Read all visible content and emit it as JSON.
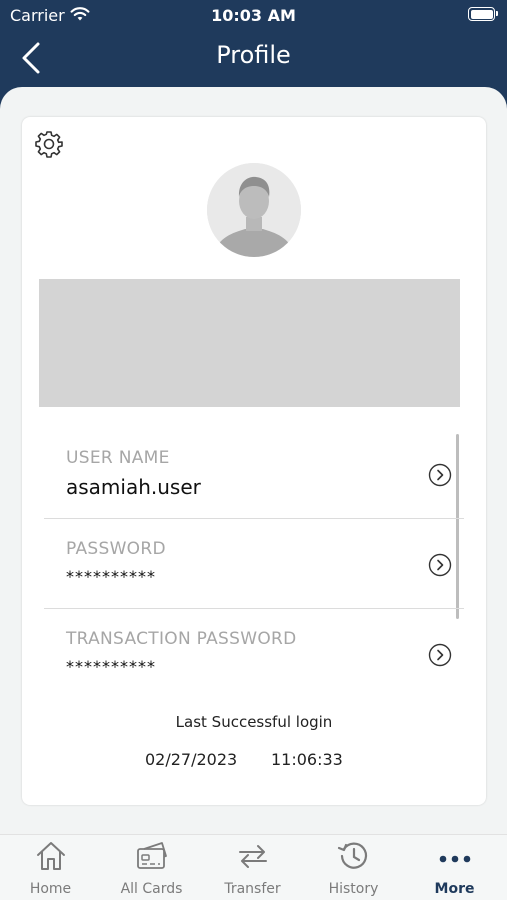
{
  "status_bar": {
    "carrier": "Carrier",
    "time": "10:03 AM",
    "battery_level": 1.0
  },
  "nav": {
    "title": "Profile",
    "back_icon": "chevron-left-icon"
  },
  "profile": {
    "settings_icon": "gear-icon",
    "avatar_icon": "user-silhouette-icon",
    "fields": [
      {
        "label": "USER NAME",
        "value": "asamiah.user"
      },
      {
        "label": "PASSWORD",
        "value": "**********"
      },
      {
        "label": "TRANSACTION PASSWORD",
        "value": "**********"
      }
    ],
    "last_login_label": "Last Successful login",
    "last_login_date": "02/27/2023",
    "last_login_time": "11:06:33"
  },
  "tabs": [
    {
      "label": "Home",
      "icon": "home-icon"
    },
    {
      "label": "All Cards",
      "icon": "card-icon"
    },
    {
      "label": "Transfer",
      "icon": "transfer-arrows-icon"
    },
    {
      "label": "History",
      "icon": "history-clock-icon"
    },
    {
      "label": "More",
      "icon": "more-dots-icon",
      "active": true
    }
  ],
  "colors": {
    "primary": "#1f3a5c",
    "background": "#f2f4f4",
    "placeholder_banner": "#d4d4d4",
    "muted_label": "#a6a6a6"
  }
}
